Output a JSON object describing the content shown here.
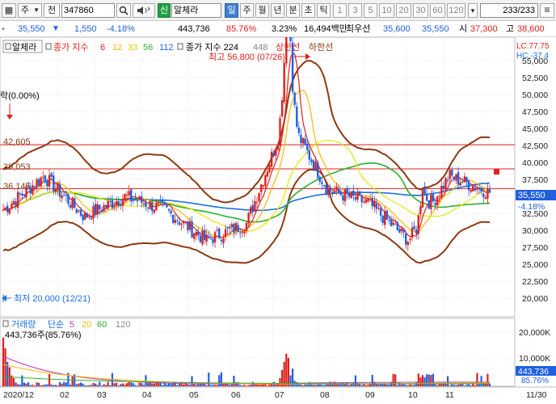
{
  "toolbar": {
    "period_selector": "주",
    "prev_label": "전",
    "code": "347860",
    "search_icon_glyph": "🔍",
    "speaker_icon_glyph": "◀",
    "market_badge": "신",
    "stock_name": "알체라",
    "periods": [
      "일",
      "주",
      "월",
      "년",
      "분",
      "초",
      "틱"
    ],
    "active_period": "일",
    "intervals": [
      "1",
      "3",
      "5",
      "10",
      "20",
      "30",
      "60",
      "120"
    ],
    "count_display": "233/233"
  },
  "quote": {
    "price": "35,550",
    "arrow": "▼",
    "change": "1,550",
    "change_pct": "-4.18%",
    "volume": "443,736",
    "volume_ratio": "85.76%",
    "turnover_pct": "3.23%",
    "amount": "16,494백만",
    "best_label": "최우선",
    "best_ask": "35,600",
    "best_bid": "35,550",
    "open_label": "시",
    "open": "37,300",
    "high_label": "고",
    "high": "38,600"
  },
  "chart_header": {
    "name": "알체라",
    "ma_title": "종가 지수",
    "ma_periods": [
      "6",
      "12",
      "33",
      "56",
      "112"
    ],
    "env_title": "종가 지수 224",
    "env_value": "448",
    "upper_label": "상한선",
    "lower_label": "하한선",
    "lc_label": "LC:77.75",
    "hc_label": "HC:-37.4"
  },
  "annotations": {
    "high_mark": "최고 56,800 (07/26)",
    "low_mark": "최저 20,000 (12/21)",
    "left_top": "락(0.00%)",
    "h1": "42,605",
    "h2": "39,053",
    "h3": "36,145",
    "price_tag": "35,550",
    "pct_tag": "-4.18%"
  },
  "volume_header": {
    "title": "거래량",
    "ma_title": "단순",
    "ma_periods": [
      "5",
      "20",
      "60",
      "120"
    ],
    "value": "443,736주(85.76%)",
    "tag_value": "443,736",
    "tag_pct": "85.76%"
  },
  "colors": {
    "up": "#e0201b",
    "down": "#1f5fe0",
    "band": "#8b3a12",
    "ma6": "#e0201b",
    "ma12": "#ffb800",
    "ma33": "#e8e800",
    "ma56": "#2db02d",
    "ma112": "#1d6fe0"
  },
  "chart_data": [
    {
      "type": "line",
      "title": "알체라",
      "y_axis_ticks": [
        "55,000",
        "52,500",
        "50,000",
        "47,500",
        "45,000",
        "42,500",
        "40,000",
        "37,500",
        "35,000",
        "32,500",
        "30,000",
        "27,500",
        "25,000",
        "22,500",
        "20,000"
      ],
      "ylim": [
        17500,
        56800
      ],
      "x_axis_ticks": [
        "2020/12",
        "02",
        "03",
        "04",
        "05",
        "06",
        "07",
        "08",
        "09",
        "10",
        "11",
        "11/30"
      ],
      "horizontal_levels": [
        42605,
        39053,
        36145
      ],
      "high": 56800,
      "low": 20000,
      "last_close": 35550,
      "series": [
        {
          "name": "종가",
          "monthly_approx": [
            [
              "2020/12",
              33000
            ],
            [
              "01",
              38000
            ],
            [
              "02",
              32000
            ],
            [
              "03",
              35000
            ],
            [
              "04",
              33000
            ],
            [
              "05",
              28500
            ],
            [
              "06",
              31000
            ],
            [
              "07",
              47000
            ],
            [
              "08",
              36000
            ],
            [
              "09",
              34000
            ],
            [
              "10",
              28500
            ],
            [
              "11",
              38000
            ],
            [
              "11/30",
              35550
            ]
          ]
        }
      ]
    },
    {
      "type": "bar",
      "title": "거래량",
      "y_axis_ticks": [
        "20,000K",
        "10,000K"
      ],
      "last_value": 443736
    }
  ]
}
